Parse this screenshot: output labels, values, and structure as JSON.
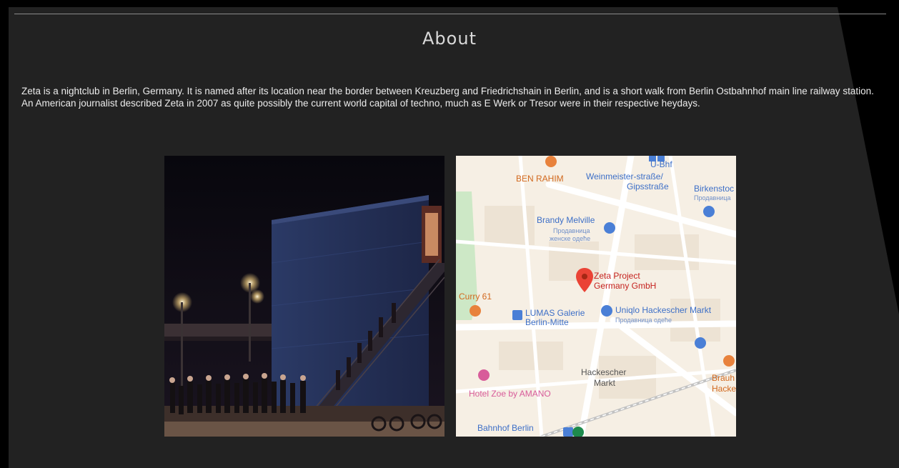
{
  "page": {
    "title": "About",
    "description": "Zeta is a nightclub in Berlin, Germany. It is named after its location near the border between Kreuzberg and Friedrichshain in Berlin, and is a short walk from Berlin Ostbahnhof main line railway station. An American journalist described Zeta in 2007 as quite possibly the current world capital of techno, much as E Werk or Tresor were in their respective heydays."
  },
  "colors": {
    "panel_bg": "#222222",
    "title_text": "#d9d9d9",
    "body_text": "#ececec",
    "map_marker": "#ea4335",
    "map_poi_blue": "#4a7fd6",
    "map_poi_orange": "#e8823c",
    "map_poi_pink": "#d85c9a"
  },
  "map": {
    "labels": {
      "u_bhf": "U-Bhf",
      "ben_rahim": "BEN RAHIM",
      "weinmeister": "Weinmeister-straße/",
      "gipsstrasse": "Gipsstraße",
      "birkenstock": "Birkenstoc",
      "birkenstock_sub": "Продавница",
      "brandy": "Brandy Melville",
      "brandy_sub1": "Продавница",
      "brandy_sub2": "женске одеће",
      "zeta1": "Zeta Project",
      "zeta2": "Germany GmbH",
      "curry": "Curry 61",
      "lumas1": "LUMAS Galerie",
      "lumas2": "Berlin-Mitte",
      "uniqlo": "Uniqlo Hackescher Markt",
      "uniqlo_sub": "Продавница одеће",
      "hackescher1": "Hackescher",
      "hackescher2": "Markt",
      "brauh1": "Brauh",
      "brauh2": "Hacke",
      "hotel": "Hotel Zoe by AMANO",
      "bahnhof": "Bahnhof Berlin"
    }
  }
}
